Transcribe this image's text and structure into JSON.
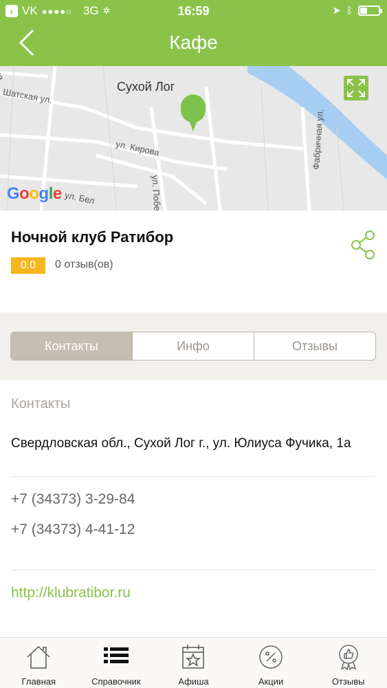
{
  "status_bar": {
    "carrier": "VK",
    "network": "3G",
    "time": "16:59"
  },
  "nav": {
    "title": "Кафе"
  },
  "map": {
    "city_label": "Сухой Лог",
    "streets": {
      "kirova": "ул. Кирова",
      "fabrichnaya": "Фабричная ул.",
      "pobedy": "ул. Побе",
      "bel": "ул. Бел",
      "tatskaya": "Шатская ул.",
      "na": "на"
    },
    "provider": [
      "G",
      "o",
      "o",
      "g",
      "l",
      "e"
    ]
  },
  "place": {
    "title": "Ночной клуб Ратибор",
    "rating": "0.0",
    "reviews": "0 отзыв(ов)"
  },
  "tabs": [
    {
      "label": "Контакты",
      "active": true
    },
    {
      "label": "Инфо",
      "active": false
    },
    {
      "label": "Отзывы",
      "active": false
    }
  ],
  "contacts": {
    "section_title": "Контакты",
    "address": "Свердловская обл., Сухой Лог г., ул. Юлиуса Фучика, 1а",
    "phones": [
      "+7 (34373) 3-29-84",
      "+7 (34373) 4-41-12"
    ],
    "website": "http://klubratibor.ru"
  },
  "bottom_nav": [
    {
      "label": "Главная",
      "icon": "home-icon"
    },
    {
      "label": "Справочник",
      "icon": "list-icon"
    },
    {
      "label": "Афиша",
      "icon": "calendar-star-icon"
    },
    {
      "label": "Акции",
      "icon": "percent-icon"
    },
    {
      "label": "Отзывы",
      "icon": "thumbs-up-badge-icon"
    }
  ],
  "colors": {
    "accent": "#8bc34a",
    "rating": "#f6b61e",
    "tab_active": "#c6beb2"
  }
}
